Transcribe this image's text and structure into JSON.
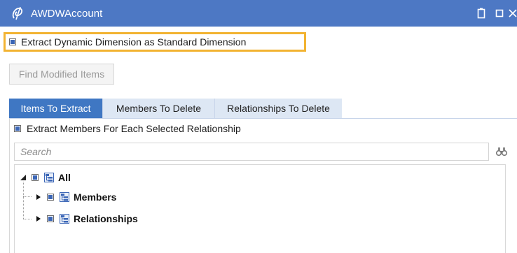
{
  "window": {
    "title": "AWDWAccount",
    "logo_icon": "opensource-logo-icon",
    "buttons": [
      "mobile-icon",
      "restore-icon",
      "close-icon"
    ]
  },
  "extract_dynamic_option": {
    "label": "Extract Dynamic Dimension as Standard Dimension",
    "checked": "indeterminate"
  },
  "find_button": {
    "label": "Find Modified Items",
    "enabled": false
  },
  "tabs": [
    {
      "label": "Items To Extract",
      "active": true
    },
    {
      "label": "Members To Delete",
      "active": false
    },
    {
      "label": "Relationships To Delete",
      "active": false
    }
  ],
  "extract_members_option": {
    "label": "Extract Members For Each Selected Relationship",
    "checked": "indeterminate"
  },
  "search": {
    "placeholder": "Search",
    "value": ""
  },
  "tree": {
    "nodes": [
      {
        "label": "All",
        "expanded": true,
        "icon": "hierarchy-icon"
      },
      {
        "label": "Members",
        "expanded": false,
        "icon": "hierarchy-icon"
      },
      {
        "label": "Relationships",
        "expanded": false,
        "icon": "hierarchy-icon"
      }
    ]
  },
  "colors": {
    "titlebar": "#4d78c4",
    "active_tab": "#3f77c3",
    "inactive_tab": "#dde7f4",
    "highlight_border": "#f2b332",
    "checkbox_fill": "#3b66b6"
  }
}
